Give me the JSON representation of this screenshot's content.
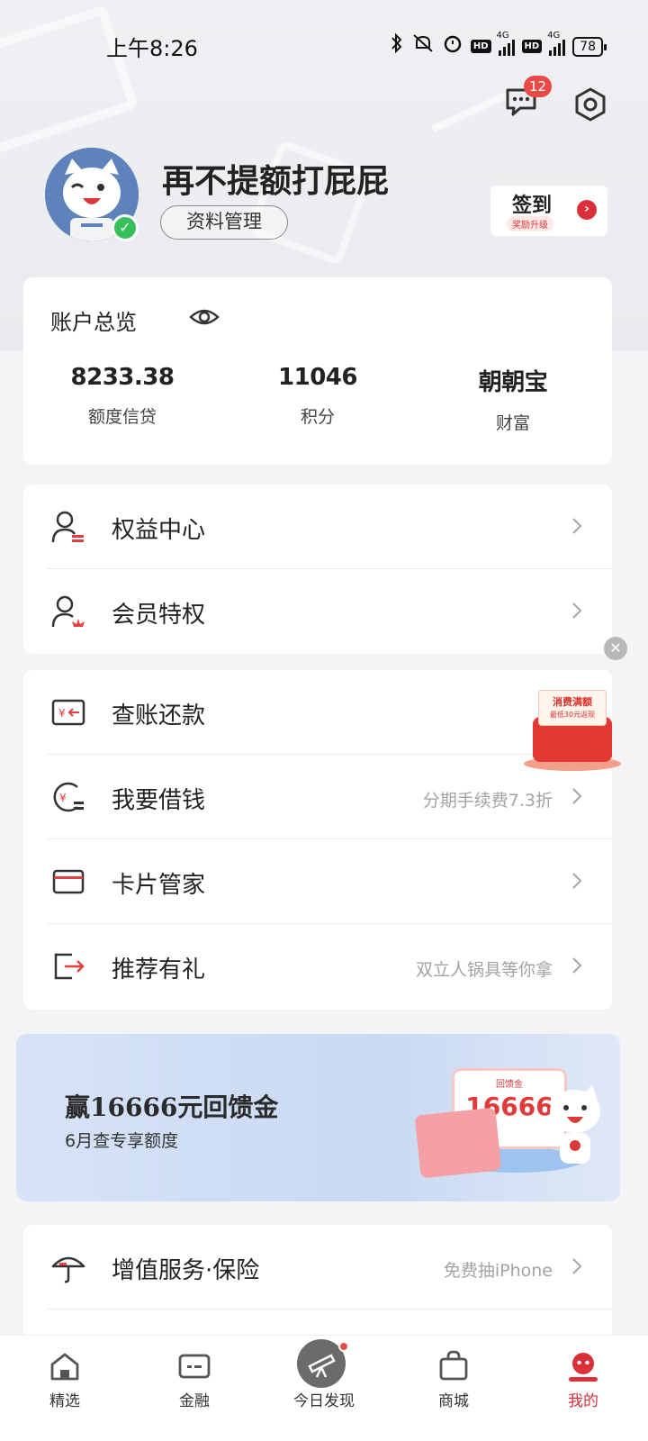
{
  "status_bar": {
    "time": "上午8:26",
    "network_1": "4G",
    "network_2": "4G",
    "hd": "HD",
    "battery": "78"
  },
  "header": {
    "message_badge": "12"
  },
  "profile": {
    "username": "再不提额打屁屁",
    "manage_label": "资料管理",
    "checkin_label": "签到",
    "checkin_sub": "奖励升级"
  },
  "account": {
    "title": "账户总览",
    "stats": [
      {
        "value": "8233.38",
        "label": "额度信贷"
      },
      {
        "value": "11046",
        "label": "积分"
      },
      {
        "value": "朝朝宝",
        "label": "财富"
      }
    ]
  },
  "menu_group_1": [
    {
      "label": "权益中心",
      "icon": "user-benefit-icon"
    },
    {
      "label": "会员特权",
      "icon": "user-crown-icon"
    }
  ],
  "menu_group_2": [
    {
      "label": "查账还款",
      "hint": "",
      "icon": "bill-repay-icon"
    },
    {
      "label": "我要借钱",
      "hint": "分期手续费7.3折",
      "icon": "borrow-money-icon"
    },
    {
      "label": "卡片管家",
      "hint": "",
      "icon": "card-icon"
    },
    {
      "label": "推荐有礼",
      "hint": "双立人锅具等你拿",
      "icon": "share-exit-icon"
    }
  ],
  "float_promo": {
    "line1": "消费满额",
    "line2": "最低30元返现"
  },
  "banner": {
    "title": "赢16666元回馈金",
    "subtitle": "6月查专享额度",
    "card_top": "回馈金",
    "card_num": "16666"
  },
  "menu_group_3": [
    {
      "label": "增值服务·保险",
      "hint": "免费抽iPhone",
      "icon": "umbrella-icon"
    }
  ],
  "bottom_nav": [
    {
      "label": "精选",
      "icon": "home-icon",
      "active": false
    },
    {
      "label": "金融",
      "icon": "finance-card-icon",
      "active": false
    },
    {
      "label": "今日发现",
      "icon": "telescope-icon",
      "active": false
    },
    {
      "label": "商城",
      "icon": "shopping-bag-icon",
      "active": false
    },
    {
      "label": "我的",
      "icon": "my-profile-icon",
      "active": true
    }
  ],
  "colors": {
    "accent": "#d9303a",
    "badge": "#e84a46",
    "verified": "#37c05a",
    "background": "#f4f4f6"
  }
}
